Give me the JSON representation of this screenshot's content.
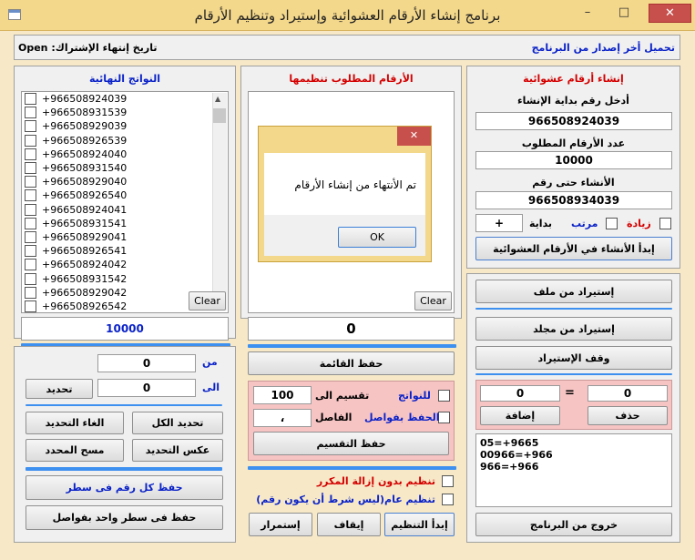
{
  "window": {
    "title": "برنامج إنشاء الأرقام العشوائية وإستيراد وتنظيم الأرقام",
    "minimize": "–",
    "maximize": "□",
    "close": "✕"
  },
  "topbar": {
    "download_link": "تحميل أخر إصدار من البرنامج",
    "expiry_label": "تاريخ إنتهاء الإشتراك:",
    "expiry_value": "Open"
  },
  "generate": {
    "header": "إنشاء أرقام عشوائية",
    "start_label": "أدخل رقم بداية الإنشاء",
    "start_value": "966508924039",
    "count_label": "عدد الأرقام المطلوب",
    "count_value": "10000",
    "until_label": "الأنشاء حتى رقم",
    "until_value": "966508934039",
    "increase_label": "زيادة",
    "ordered_label": "مرتب",
    "prefix_label": "بداية",
    "prefix_value": "+",
    "start_button": "إبدأ الأنشاء في الأرقام العشوائية"
  },
  "import": {
    "from_file": "إستيراد من ملف",
    "from_folder": "إستيراد من مجلد",
    "stop": "وقف الإستيراد"
  },
  "replace": {
    "left_value": "0",
    "equals": "=",
    "right_value": "0",
    "add_button": "إضافة",
    "delete_button": "حذف",
    "rules": [
      "05=+9665",
      "00966=+966",
      "966=+966"
    ]
  },
  "exit_button": "خروج من البرنامج",
  "organize": {
    "header": "الأرقام المطلوب تنظيمها",
    "clear": "Clear",
    "count": "0",
    "save_list": "حفظ القائمة",
    "split_label": "تقسيم الى",
    "split_value": "100",
    "results_label": "للنواتج",
    "separator_label": "الفاصل",
    "separator_value": "،",
    "save_with_sep_label": "الحفظ بفواصل",
    "save_split": "حفظ التقسيم",
    "no_dedupe_label": "تنظيم بدون إزالة المكرر",
    "general_label": "تنظيم عام(ليس شرط أن يكون رقم)",
    "start": "إبدأ التنظيم",
    "stop": "إيقاف",
    "continue": "إستمرار"
  },
  "dialog": {
    "message": "تم الأنتهاء من إنشاء الأرقام",
    "ok": "OK",
    "close": "✕"
  },
  "results": {
    "header": "النواتج النهائية",
    "items": [
      "+966508924039",
      "+966508931539",
      "+966508929039",
      "+966508926539",
      "+966508924040",
      "+966508931540",
      "+966508929040",
      "+966508926540",
      "+966508924041",
      "+966508931541",
      "+966508929041",
      "+966508926541",
      "+966508924042",
      "+966508931542",
      "+966508929042",
      "+966508926542"
    ],
    "clear": "Clear",
    "count": "10000",
    "from_label": "من",
    "from_value": "0",
    "to_label": "الى",
    "to_value": "0",
    "select_button": "تحديد",
    "select_all": "تحديد الكل",
    "deselect": "الغاء التحديد",
    "invert": "عكس التحديد",
    "delete_selected": "مسح المحدد",
    "save_each_line": "حفظ كل رقم فى سطر",
    "save_one_line": "حفظ فى سطر واحد بفواصل"
  }
}
